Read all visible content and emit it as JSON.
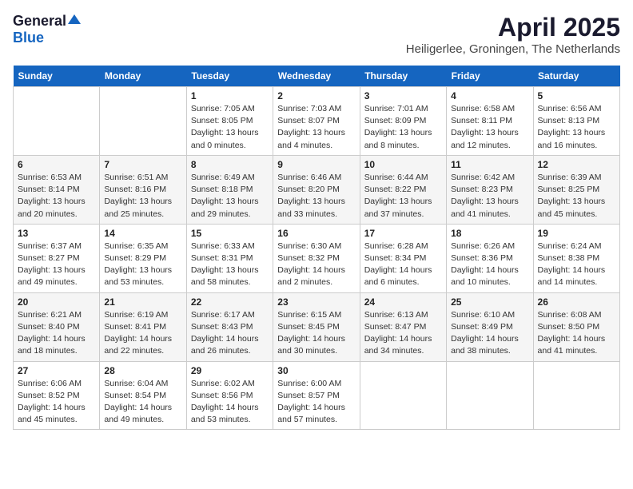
{
  "header": {
    "logo_general": "General",
    "logo_blue": "Blue",
    "title": "April 2025",
    "subtitle": "Heiligerlee, Groningen, The Netherlands"
  },
  "days_of_week": [
    "Sunday",
    "Monday",
    "Tuesday",
    "Wednesday",
    "Thursday",
    "Friday",
    "Saturday"
  ],
  "weeks": [
    [
      {
        "day": "",
        "info": ""
      },
      {
        "day": "",
        "info": ""
      },
      {
        "day": "1",
        "info": "Sunrise: 7:05 AM\nSunset: 8:05 PM\nDaylight: 13 hours\nand 0 minutes."
      },
      {
        "day": "2",
        "info": "Sunrise: 7:03 AM\nSunset: 8:07 PM\nDaylight: 13 hours\nand 4 minutes."
      },
      {
        "day": "3",
        "info": "Sunrise: 7:01 AM\nSunset: 8:09 PM\nDaylight: 13 hours\nand 8 minutes."
      },
      {
        "day": "4",
        "info": "Sunrise: 6:58 AM\nSunset: 8:11 PM\nDaylight: 13 hours\nand 12 minutes."
      },
      {
        "day": "5",
        "info": "Sunrise: 6:56 AM\nSunset: 8:13 PM\nDaylight: 13 hours\nand 16 minutes."
      }
    ],
    [
      {
        "day": "6",
        "info": "Sunrise: 6:53 AM\nSunset: 8:14 PM\nDaylight: 13 hours\nand 20 minutes."
      },
      {
        "day": "7",
        "info": "Sunrise: 6:51 AM\nSunset: 8:16 PM\nDaylight: 13 hours\nand 25 minutes."
      },
      {
        "day": "8",
        "info": "Sunrise: 6:49 AM\nSunset: 8:18 PM\nDaylight: 13 hours\nand 29 minutes."
      },
      {
        "day": "9",
        "info": "Sunrise: 6:46 AM\nSunset: 8:20 PM\nDaylight: 13 hours\nand 33 minutes."
      },
      {
        "day": "10",
        "info": "Sunrise: 6:44 AM\nSunset: 8:22 PM\nDaylight: 13 hours\nand 37 minutes."
      },
      {
        "day": "11",
        "info": "Sunrise: 6:42 AM\nSunset: 8:23 PM\nDaylight: 13 hours\nand 41 minutes."
      },
      {
        "day": "12",
        "info": "Sunrise: 6:39 AM\nSunset: 8:25 PM\nDaylight: 13 hours\nand 45 minutes."
      }
    ],
    [
      {
        "day": "13",
        "info": "Sunrise: 6:37 AM\nSunset: 8:27 PM\nDaylight: 13 hours\nand 49 minutes."
      },
      {
        "day": "14",
        "info": "Sunrise: 6:35 AM\nSunset: 8:29 PM\nDaylight: 13 hours\nand 53 minutes."
      },
      {
        "day": "15",
        "info": "Sunrise: 6:33 AM\nSunset: 8:31 PM\nDaylight: 13 hours\nand 58 minutes."
      },
      {
        "day": "16",
        "info": "Sunrise: 6:30 AM\nSunset: 8:32 PM\nDaylight: 14 hours\nand 2 minutes."
      },
      {
        "day": "17",
        "info": "Sunrise: 6:28 AM\nSunset: 8:34 PM\nDaylight: 14 hours\nand 6 minutes."
      },
      {
        "day": "18",
        "info": "Sunrise: 6:26 AM\nSunset: 8:36 PM\nDaylight: 14 hours\nand 10 minutes."
      },
      {
        "day": "19",
        "info": "Sunrise: 6:24 AM\nSunset: 8:38 PM\nDaylight: 14 hours\nand 14 minutes."
      }
    ],
    [
      {
        "day": "20",
        "info": "Sunrise: 6:21 AM\nSunset: 8:40 PM\nDaylight: 14 hours\nand 18 minutes."
      },
      {
        "day": "21",
        "info": "Sunrise: 6:19 AM\nSunset: 8:41 PM\nDaylight: 14 hours\nand 22 minutes."
      },
      {
        "day": "22",
        "info": "Sunrise: 6:17 AM\nSunset: 8:43 PM\nDaylight: 14 hours\nand 26 minutes."
      },
      {
        "day": "23",
        "info": "Sunrise: 6:15 AM\nSunset: 8:45 PM\nDaylight: 14 hours\nand 30 minutes."
      },
      {
        "day": "24",
        "info": "Sunrise: 6:13 AM\nSunset: 8:47 PM\nDaylight: 14 hours\nand 34 minutes."
      },
      {
        "day": "25",
        "info": "Sunrise: 6:10 AM\nSunset: 8:49 PM\nDaylight: 14 hours\nand 38 minutes."
      },
      {
        "day": "26",
        "info": "Sunrise: 6:08 AM\nSunset: 8:50 PM\nDaylight: 14 hours\nand 41 minutes."
      }
    ],
    [
      {
        "day": "27",
        "info": "Sunrise: 6:06 AM\nSunset: 8:52 PM\nDaylight: 14 hours\nand 45 minutes."
      },
      {
        "day": "28",
        "info": "Sunrise: 6:04 AM\nSunset: 8:54 PM\nDaylight: 14 hours\nand 49 minutes."
      },
      {
        "day": "29",
        "info": "Sunrise: 6:02 AM\nSunset: 8:56 PM\nDaylight: 14 hours\nand 53 minutes."
      },
      {
        "day": "30",
        "info": "Sunrise: 6:00 AM\nSunset: 8:57 PM\nDaylight: 14 hours\nand 57 minutes."
      },
      {
        "day": "",
        "info": ""
      },
      {
        "day": "",
        "info": ""
      },
      {
        "day": "",
        "info": ""
      }
    ]
  ]
}
